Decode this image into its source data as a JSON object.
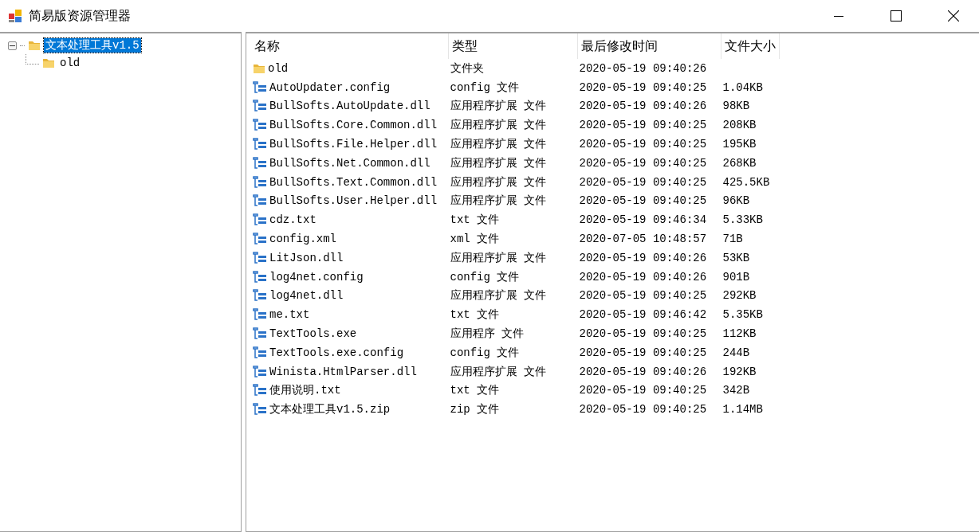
{
  "window": {
    "title": "简易版资源管理器"
  },
  "tree": [
    {
      "label": "文本处理工具v1.5",
      "selected": true,
      "expanded": true,
      "children": [
        {
          "label": "old",
          "selected": false
        }
      ]
    }
  ],
  "table": {
    "columns": [
      "名称",
      "类型",
      "最后修改时间",
      "文件大小"
    ],
    "rows": [
      {
        "kind": "folder",
        "name": "old",
        "type": "文件夹",
        "modified": "2020-05-19 09:40:26"
      },
      {
        "kind": "file",
        "name": "AutoUpdater.config",
        "type": "config 文件",
        "modified": "2020-05-19 09:40:25",
        "size": "1.04KB"
      },
      {
        "kind": "file",
        "name": "BullSofts.AutoUpdate.dll",
        "type": "应用程序扩展 文件",
        "modified": "2020-05-19 09:40:26",
        "size": "98KB"
      },
      {
        "kind": "file",
        "name": "BullSofts.Core.Common.dll",
        "type": "应用程序扩展 文件",
        "modified": "2020-05-19 09:40:25",
        "size": "208KB"
      },
      {
        "kind": "file",
        "name": "BullSofts.File.Helper.dll",
        "type": "应用程序扩展 文件",
        "modified": "2020-05-19 09:40:25",
        "size": "195KB"
      },
      {
        "kind": "file",
        "name": "BullSofts.Net.Common.dll",
        "type": "应用程序扩展 文件",
        "modified": "2020-05-19 09:40:25",
        "size": "268KB"
      },
      {
        "kind": "file",
        "name": "BullSofts.Text.Common.dll",
        "type": "应用程序扩展 文件",
        "modified": "2020-05-19 09:40:25",
        "size": "425.5KB"
      },
      {
        "kind": "file",
        "name": "BullSofts.User.Helper.dll",
        "type": "应用程序扩展 文件",
        "modified": "2020-05-19 09:40:25",
        "size": "96KB"
      },
      {
        "kind": "file",
        "name": "cdz.txt",
        "type": "txt 文件",
        "modified": "2020-05-19 09:46:34",
        "size": "5.33KB"
      },
      {
        "kind": "file",
        "name": "config.xml",
        "type": "xml 文件",
        "modified": "2020-07-05 10:48:57",
        "size": "71B"
      },
      {
        "kind": "file",
        "name": "LitJson.dll",
        "type": "应用程序扩展 文件",
        "modified": "2020-05-19 09:40:26",
        "size": "53KB"
      },
      {
        "kind": "file",
        "name": "log4net.config",
        "type": "config 文件",
        "modified": "2020-05-19 09:40:26",
        "size": "901B"
      },
      {
        "kind": "file",
        "name": "log4net.dll",
        "type": "应用程序扩展 文件",
        "modified": "2020-05-19 09:40:25",
        "size": "292KB"
      },
      {
        "kind": "file",
        "name": "me.txt",
        "type": "txt 文件",
        "modified": "2020-05-19 09:46:42",
        "size": "5.35KB"
      },
      {
        "kind": "file",
        "name": "TextTools.exe",
        "type": "应用程序 文件",
        "modified": "2020-05-19 09:40:25",
        "size": "112KB"
      },
      {
        "kind": "file",
        "name": "TextTools.exe.config",
        "type": "config 文件",
        "modified": "2020-05-19 09:40:25",
        "size": "244B"
      },
      {
        "kind": "file",
        "name": "Winista.HtmlParser.dll",
        "type": "应用程序扩展 文件",
        "modified": "2020-05-19 09:40:26",
        "size": "192KB"
      },
      {
        "kind": "file",
        "name": "使用说明.txt",
        "type": "txt 文件",
        "modified": "2020-05-19 09:40:25",
        "size": "342B"
      },
      {
        "kind": "file",
        "name": "文本处理工具v1.5.zip",
        "type": "zip 文件",
        "modified": "2020-05-19 09:40:25",
        "size": "1.14MB"
      }
    ]
  }
}
